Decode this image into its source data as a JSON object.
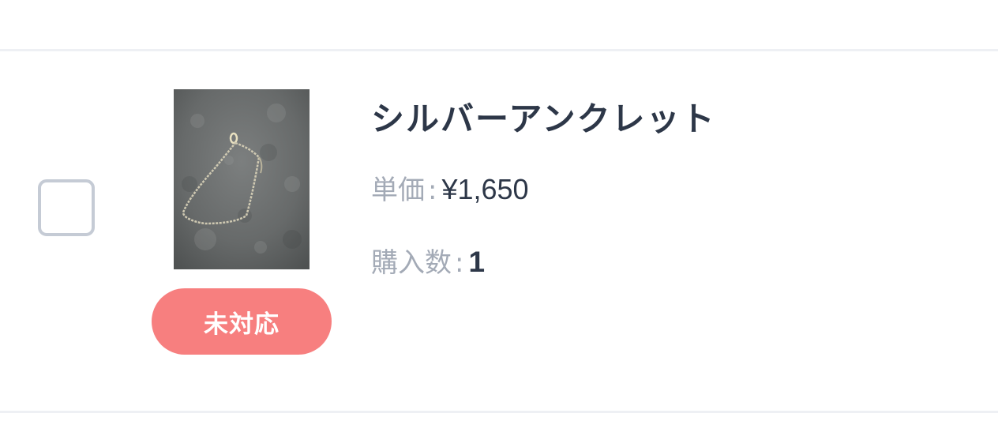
{
  "order_item": {
    "product_name": "シルバーアンクレット",
    "status_label": "未対応",
    "unit_price": {
      "label": "単価",
      "separator": ":",
      "value": "¥1,650"
    },
    "quantity": {
      "label": "購入数",
      "separator": ":",
      "value": "1"
    },
    "checked": false,
    "image_icon": "product-photo-anklet"
  },
  "colors": {
    "status_badge": "#f77f7f",
    "text_primary": "#2d3748",
    "text_muted": "#a3aab6",
    "checkbox_border": "#c5cbd5",
    "divider": "#eef0f4"
  }
}
